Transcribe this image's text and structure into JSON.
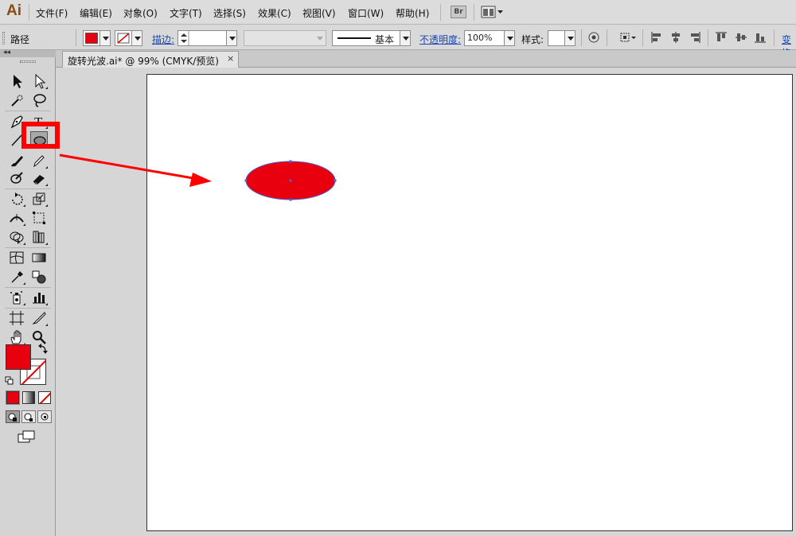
{
  "app": {
    "logo": "Ai"
  },
  "menu": [
    "文件(F)",
    "编辑(E)",
    "对象(O)",
    "文字(T)",
    "选择(S)",
    "效果(C)",
    "视图(V)",
    "窗口(W)",
    "帮助(H)"
  ],
  "bridge_button": "Br",
  "control": {
    "selection_type": "路径",
    "fill_color": "#e8000f",
    "stroke_label": "描边:",
    "stroke_weight": "",
    "brush_style": "",
    "profile_label": "基本",
    "opacity_label": "不透明度:",
    "opacity_value": "100%",
    "style_label": "样式:",
    "transform_label": "变换"
  },
  "document_tab": {
    "title": "旋转光波.ai* @ 99% (CMYK/预览)",
    "close": "×"
  },
  "tools": [
    "selection-tool",
    "direct-selection-tool",
    "magic-wand-tool",
    "lasso-tool",
    "pen-tool",
    "type-tool",
    "line-segment-tool",
    "ellipse-tool",
    "paintbrush-tool",
    "pencil-tool",
    "blob-brush-tool",
    "eraser-tool",
    "rotate-tool",
    "scale-tool",
    "width-tool",
    "free-transform-tool",
    "shape-builder-tool",
    "perspective-grid-tool",
    "mesh-tool",
    "gradient-tool",
    "eyedropper-tool",
    "blend-tool",
    "symbol-sprayer-tool",
    "column-graph-tool",
    "artboard-tool",
    "slice-tool",
    "hand-tool",
    "zoom-tool"
  ],
  "colors": {
    "fill": "#e8000f",
    "stroke": "none",
    "highlight": "#ff0000",
    "selection": "#4a5fd0"
  }
}
